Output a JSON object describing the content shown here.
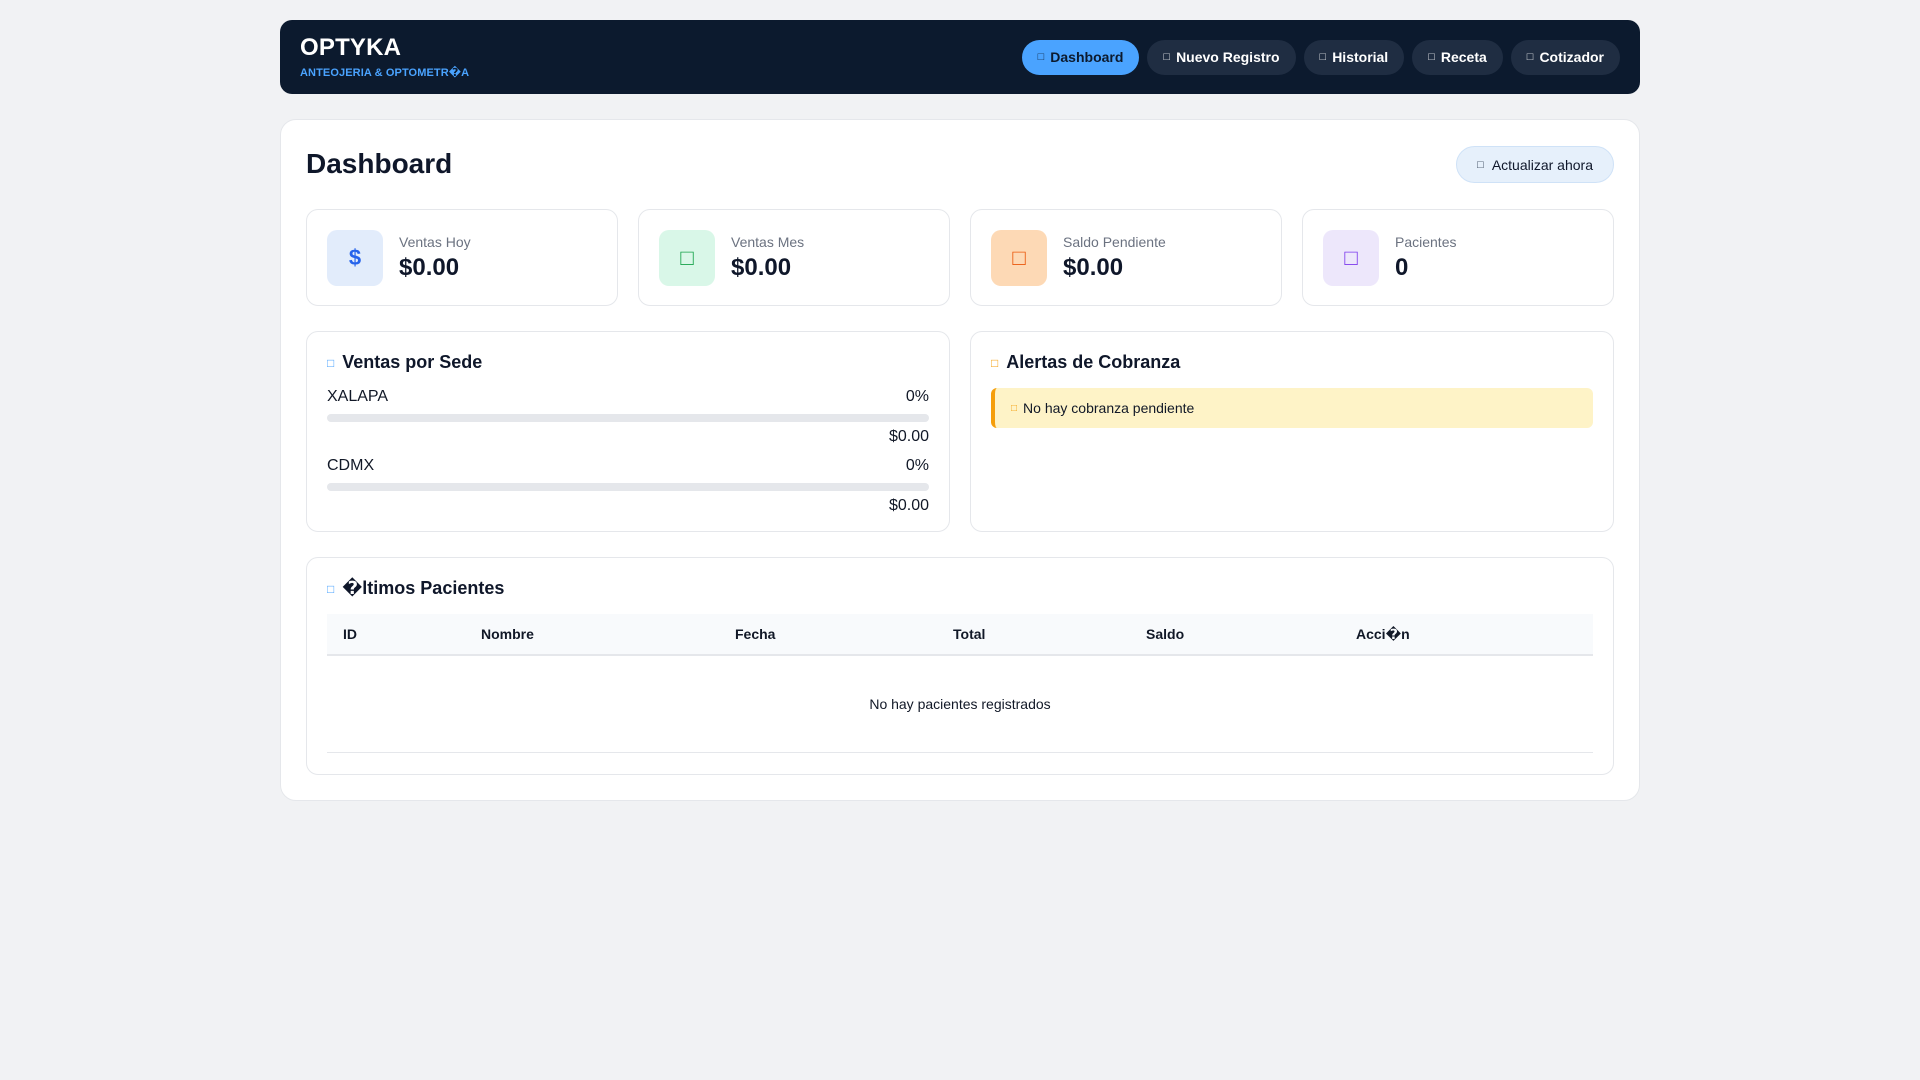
{
  "header": {
    "brand": "OPTYKA",
    "subtitle": "ANTEOJERIA & OPTOMETR�A",
    "nav": [
      {
        "label": "Dashboard",
        "icon": "gauge-icon",
        "active": true
      },
      {
        "label": "Nuevo Registro",
        "icon": "plus-icon",
        "active": false
      },
      {
        "label": "Historial",
        "icon": "history-icon",
        "active": false
      },
      {
        "label": "Receta",
        "icon": "prescription-icon",
        "active": false
      },
      {
        "label": "Cotizador",
        "icon": "calculator-icon",
        "active": false
      }
    ]
  },
  "main": {
    "title": "Dashboard",
    "refresh_label": "Actualizar ahora",
    "stats": [
      {
        "label": "Ventas Hoy",
        "value": "$0.00",
        "icon_glyph": "$",
        "icon": "dollar-icon"
      },
      {
        "label": "Ventas Mes",
        "value": "$0.00",
        "icon_glyph": "",
        "icon": "calendar-icon"
      },
      {
        "label": "Saldo Pendiente",
        "value": "$0.00",
        "icon_glyph": "",
        "icon": "wallet-icon"
      },
      {
        "label": "Pacientes",
        "value": "0",
        "icon_glyph": "",
        "icon": "users-icon"
      }
    ],
    "ventas_sede": {
      "title": "Ventas por Sede",
      "sedes": [
        {
          "name": "XALAPA",
          "percent": "0%",
          "amount": "$0.00",
          "fill": 0
        },
        {
          "name": "CDMX",
          "percent": "0%",
          "amount": "$0.00",
          "fill": 0
        }
      ]
    },
    "alertas": {
      "title": "Alertas de Cobranza",
      "message": "No hay cobranza pendiente"
    },
    "pacientes": {
      "title": "�ltimos Pacientes",
      "columns": [
        "ID",
        "Nombre",
        "Fecha",
        "Total",
        "Saldo",
        "Acci�n"
      ],
      "empty_message": "No hay pacientes registrados"
    }
  },
  "colors": {
    "header_bg": "#0c1a2e",
    "accent": "#4aa3ff",
    "warning": "#f59e0b"
  }
}
